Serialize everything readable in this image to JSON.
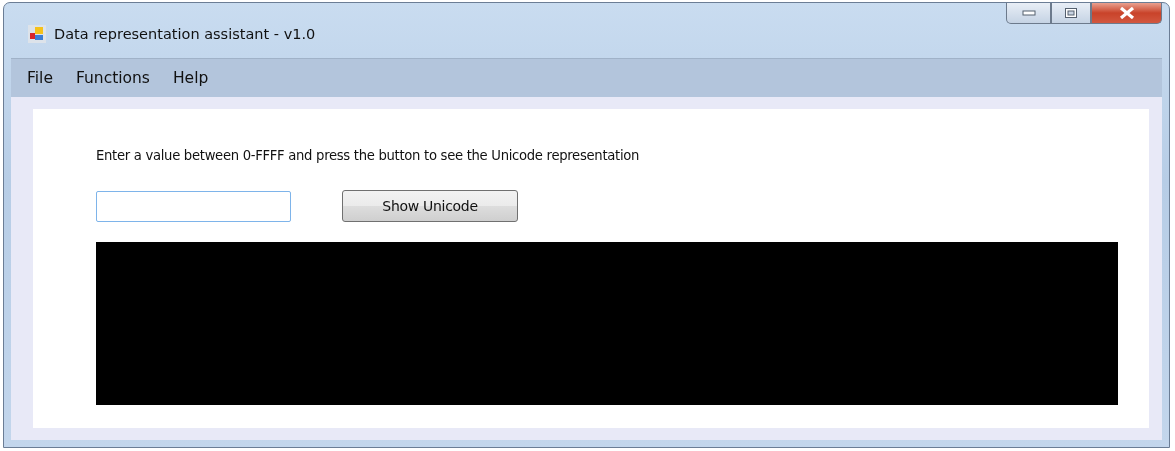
{
  "window": {
    "title": "Data representation assistant - v1.0"
  },
  "menu": [
    "File",
    "Functions",
    "Help"
  ],
  "instruction": "Enter a value between 0-FFFF and press the button to see the Unicode representation",
  "button": "Show Unicode"
}
